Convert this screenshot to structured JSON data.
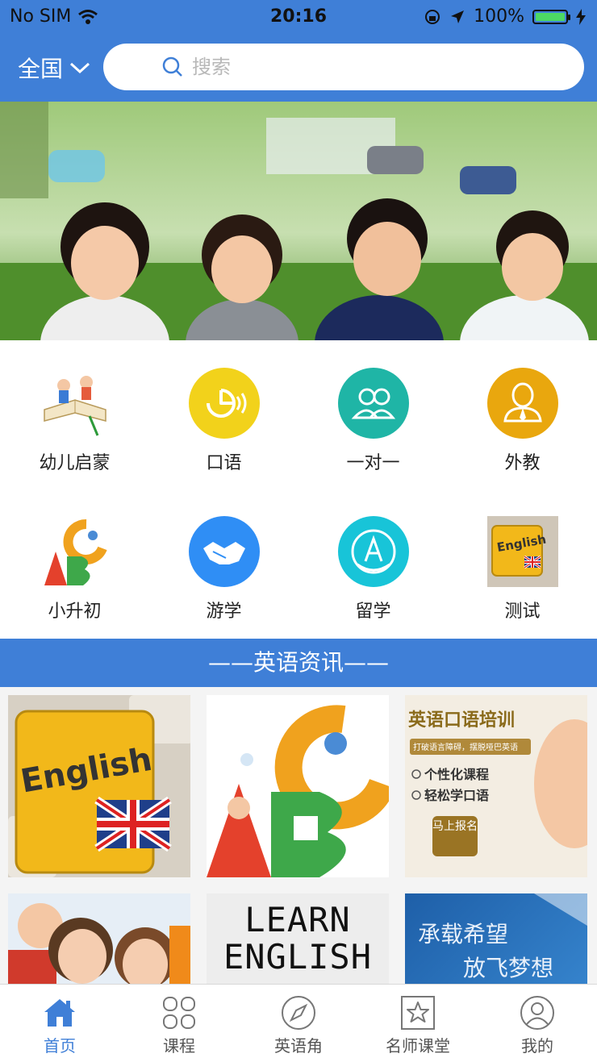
{
  "status_bar": {
    "carrier": "No SIM",
    "time": "20:16",
    "battery": "100%"
  },
  "header": {
    "region": "全国",
    "search_placeholder": "搜索"
  },
  "banner": {
    "icon": "children-on-grass-photo"
  },
  "categories": [
    {
      "label": "幼儿启蒙",
      "icon": "kids-book-icon"
    },
    {
      "label": "口语",
      "icon": "speech-icon",
      "color": "#f2d21b"
    },
    {
      "label": "一对一",
      "icon": "two-people-icon",
      "color": "#1fb5a6"
    },
    {
      "label": "外教",
      "icon": "teacher-icon",
      "color": "#e9a70e"
    },
    {
      "label": "小升初",
      "icon": "abc-icon"
    },
    {
      "label": "游学",
      "icon": "handshake-icon",
      "color": "#2f8ef5"
    },
    {
      "label": "留学",
      "icon": "graduation-icon",
      "color": "#18c4d8"
    },
    {
      "label": "测试",
      "icon": "english-key-icon"
    }
  ],
  "section": {
    "title": "——英语资讯——"
  },
  "news": [
    {
      "text": "English"
    },
    {
      "text": ""
    },
    {
      "title": "英语口语培训",
      "subtitle": "打破语言障碍，摆脱哑巴英语",
      "points": [
        "个性化课程",
        "轻松学口语"
      ],
      "button": "马上报名"
    },
    {
      "text": ""
    },
    {
      "text": "LEARN ENGLISH"
    },
    {
      "line1": "承载希望",
      "line2": "放飞梦想"
    }
  ],
  "tabs": [
    {
      "label": "首页",
      "icon": "home-icon",
      "active": true
    },
    {
      "label": "课程",
      "icon": "grid-icon"
    },
    {
      "label": "英语角",
      "icon": "compass-icon"
    },
    {
      "label": "名师课堂",
      "icon": "star-box-icon"
    },
    {
      "label": "我的",
      "icon": "user-icon"
    }
  ],
  "colors": {
    "primary": "#3f7fd7",
    "active_tab": "#3f7fd7"
  }
}
